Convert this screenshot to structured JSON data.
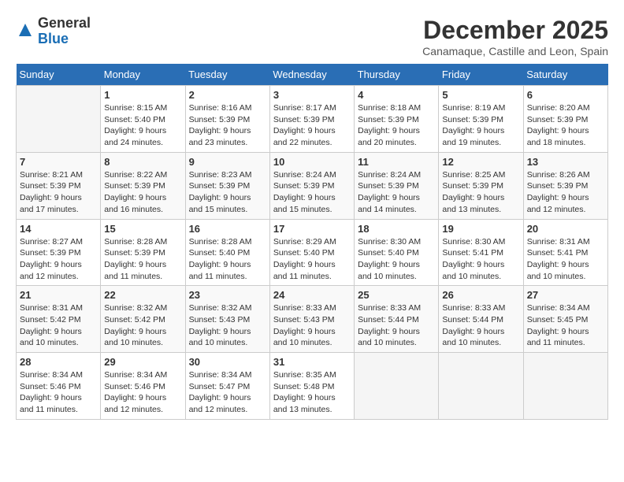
{
  "logo": {
    "general": "General",
    "blue": "Blue"
  },
  "header": {
    "month": "December 2025",
    "location": "Canamaque, Castille and Leon, Spain"
  },
  "weekdays": [
    "Sunday",
    "Monday",
    "Tuesday",
    "Wednesday",
    "Thursday",
    "Friday",
    "Saturday"
  ],
  "weeks": [
    [
      {
        "day": null
      },
      {
        "day": 1,
        "sunrise": "8:15 AM",
        "sunset": "5:40 PM",
        "daylight": "9 hours and 24 minutes."
      },
      {
        "day": 2,
        "sunrise": "8:16 AM",
        "sunset": "5:39 PM",
        "daylight": "9 hours and 23 minutes."
      },
      {
        "day": 3,
        "sunrise": "8:17 AM",
        "sunset": "5:39 PM",
        "daylight": "9 hours and 22 minutes."
      },
      {
        "day": 4,
        "sunrise": "8:18 AM",
        "sunset": "5:39 PM",
        "daylight": "9 hours and 20 minutes."
      },
      {
        "day": 5,
        "sunrise": "8:19 AM",
        "sunset": "5:39 PM",
        "daylight": "9 hours and 19 minutes."
      },
      {
        "day": 6,
        "sunrise": "8:20 AM",
        "sunset": "5:39 PM",
        "daylight": "9 hours and 18 minutes."
      }
    ],
    [
      {
        "day": 7,
        "sunrise": "8:21 AM",
        "sunset": "5:39 PM",
        "daylight": "9 hours and 17 minutes."
      },
      {
        "day": 8,
        "sunrise": "8:22 AM",
        "sunset": "5:39 PM",
        "daylight": "9 hours and 16 minutes."
      },
      {
        "day": 9,
        "sunrise": "8:23 AM",
        "sunset": "5:39 PM",
        "daylight": "9 hours and 15 minutes."
      },
      {
        "day": 10,
        "sunrise": "8:24 AM",
        "sunset": "5:39 PM",
        "daylight": "9 hours and 15 minutes."
      },
      {
        "day": 11,
        "sunrise": "8:24 AM",
        "sunset": "5:39 PM",
        "daylight": "9 hours and 14 minutes."
      },
      {
        "day": 12,
        "sunrise": "8:25 AM",
        "sunset": "5:39 PM",
        "daylight": "9 hours and 13 minutes."
      },
      {
        "day": 13,
        "sunrise": "8:26 AM",
        "sunset": "5:39 PM",
        "daylight": "9 hours and 12 minutes."
      }
    ],
    [
      {
        "day": 14,
        "sunrise": "8:27 AM",
        "sunset": "5:39 PM",
        "daylight": "9 hours and 12 minutes."
      },
      {
        "day": 15,
        "sunrise": "8:28 AM",
        "sunset": "5:39 PM",
        "daylight": "9 hours and 11 minutes."
      },
      {
        "day": 16,
        "sunrise": "8:28 AM",
        "sunset": "5:40 PM",
        "daylight": "9 hours and 11 minutes."
      },
      {
        "day": 17,
        "sunrise": "8:29 AM",
        "sunset": "5:40 PM",
        "daylight": "9 hours and 11 minutes."
      },
      {
        "day": 18,
        "sunrise": "8:30 AM",
        "sunset": "5:40 PM",
        "daylight": "9 hours and 10 minutes."
      },
      {
        "day": 19,
        "sunrise": "8:30 AM",
        "sunset": "5:41 PM",
        "daylight": "9 hours and 10 minutes."
      },
      {
        "day": 20,
        "sunrise": "8:31 AM",
        "sunset": "5:41 PM",
        "daylight": "9 hours and 10 minutes."
      }
    ],
    [
      {
        "day": 21,
        "sunrise": "8:31 AM",
        "sunset": "5:42 PM",
        "daylight": "9 hours and 10 minutes."
      },
      {
        "day": 22,
        "sunrise": "8:32 AM",
        "sunset": "5:42 PM",
        "daylight": "9 hours and 10 minutes."
      },
      {
        "day": 23,
        "sunrise": "8:32 AM",
        "sunset": "5:43 PM",
        "daylight": "9 hours and 10 minutes."
      },
      {
        "day": 24,
        "sunrise": "8:33 AM",
        "sunset": "5:43 PM",
        "daylight": "9 hours and 10 minutes."
      },
      {
        "day": 25,
        "sunrise": "8:33 AM",
        "sunset": "5:44 PM",
        "daylight": "9 hours and 10 minutes."
      },
      {
        "day": 26,
        "sunrise": "8:33 AM",
        "sunset": "5:44 PM",
        "daylight": "9 hours and 10 minutes."
      },
      {
        "day": 27,
        "sunrise": "8:34 AM",
        "sunset": "5:45 PM",
        "daylight": "9 hours and 11 minutes."
      }
    ],
    [
      {
        "day": 28,
        "sunrise": "8:34 AM",
        "sunset": "5:46 PM",
        "daylight": "9 hours and 11 minutes."
      },
      {
        "day": 29,
        "sunrise": "8:34 AM",
        "sunset": "5:46 PM",
        "daylight": "9 hours and 12 minutes."
      },
      {
        "day": 30,
        "sunrise": "8:34 AM",
        "sunset": "5:47 PM",
        "daylight": "9 hours and 12 minutes."
      },
      {
        "day": 31,
        "sunrise": "8:35 AM",
        "sunset": "5:48 PM",
        "daylight": "9 hours and 13 minutes."
      },
      {
        "day": null
      },
      {
        "day": null
      },
      {
        "day": null
      }
    ]
  ]
}
